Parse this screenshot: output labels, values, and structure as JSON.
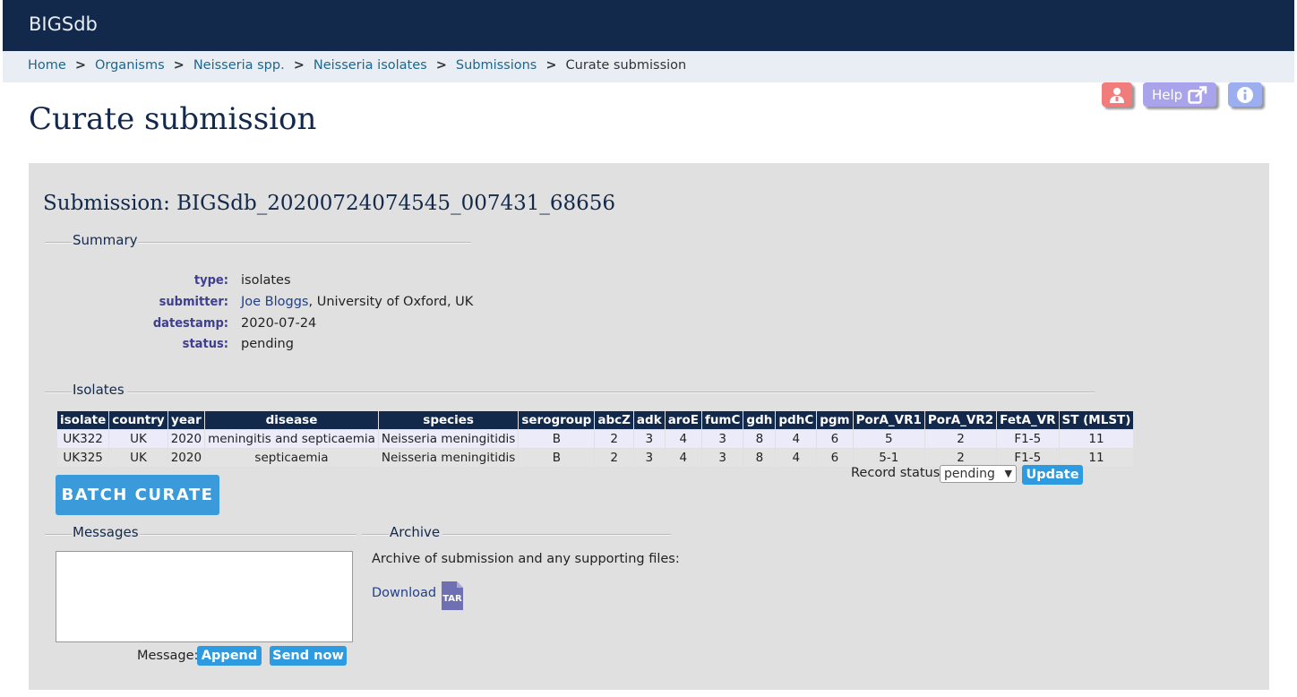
{
  "app": {
    "brand": "BIGSdb"
  },
  "breadcrumb": {
    "items": [
      "Home",
      "Organisms",
      "Neisseria spp.",
      "Neisseria isolates",
      "Submissions"
    ],
    "separator": ">",
    "current": "Curate submission"
  },
  "page_title": "Curate submission",
  "toolbar": {
    "help_label": "Help"
  },
  "submission": {
    "title": "Submission: BIGSdb_20200724074545_007431_68656",
    "summary_legend": "Summary",
    "fields": {
      "type_label": "type:",
      "type_value": "isolates",
      "submitter_label": "submitter:",
      "submitter_name": "Joe Bloggs",
      "submitter_rest": ", University of Oxford, UK",
      "datestamp_label": "datestamp:",
      "datestamp_value": "2020-07-24",
      "status_label": "status:",
      "status_value": "pending"
    }
  },
  "isolates": {
    "legend": "Isolates",
    "columns": [
      "isolate",
      "country",
      "year",
      "disease",
      "species",
      "serogroup",
      "abcZ",
      "adk",
      "aroE",
      "fumC",
      "gdh",
      "pdhC",
      "pgm",
      "PorA_VR1",
      "PorA_VR2",
      "FetA_VR",
      "ST (MLST)"
    ],
    "rows": [
      [
        "UK322",
        "UK",
        "2020",
        "meningitis and septicaemia",
        "Neisseria meningitidis",
        "B",
        "2",
        "3",
        "4",
        "3",
        "8",
        "4",
        "6",
        "5",
        "2",
        "F1-5",
        "11"
      ],
      [
        "UK325",
        "UK",
        "2020",
        "septicaemia",
        "Neisseria meningitidis",
        "B",
        "2",
        "3",
        "4",
        "3",
        "8",
        "4",
        "6",
        "5-1",
        "2",
        "F1-5",
        "11"
      ]
    ],
    "record_status_label": "Record status:",
    "record_status_value": "pending",
    "update_label": "Update",
    "batch_label": "BATCH CURATE"
  },
  "messages": {
    "legend": "Messages",
    "message_label": "Message:",
    "append_label": "Append",
    "send_label": "Send now"
  },
  "archive": {
    "legend": "Archive",
    "text": "Archive of submission and any supporting files:",
    "download_label": "Download",
    "icon_label": "TAR"
  },
  "colors": {
    "navbar": "#13294b",
    "accent": "#3b9ad9",
    "table_header": "#13294b"
  }
}
